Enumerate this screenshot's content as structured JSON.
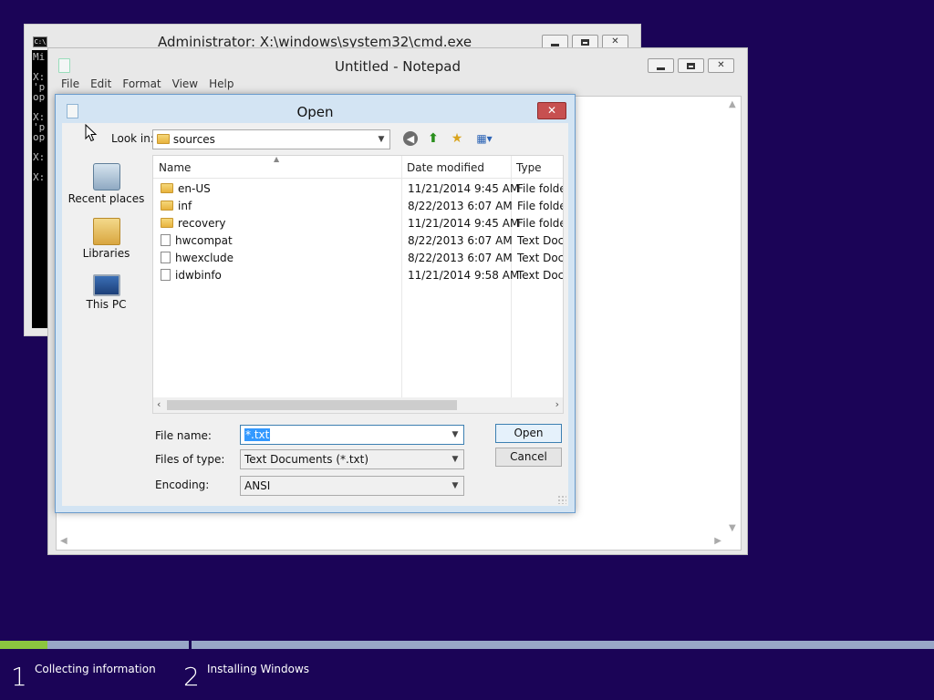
{
  "cmd": {
    "title": "Administrator: X:\\windows\\system32\\cmd.exe",
    "icon_text": "C:\\",
    "console_text": "Mi\n\nX:\n'p\nop\n\nX:\n'p\nop\n\nX:\n\nX:"
  },
  "notepad": {
    "title": "Untitled - Notepad",
    "menu": [
      "File",
      "Edit",
      "Format",
      "View",
      "Help"
    ]
  },
  "dialog": {
    "title": "Open",
    "close_glyph": "✕",
    "look_in_label": "Look in:",
    "look_in_value": "sources",
    "places": [
      {
        "label": "Recent places",
        "icon": "recent-places-icon"
      },
      {
        "label": "Libraries",
        "icon": "libraries-icon"
      },
      {
        "label": "This PC",
        "icon": "this-pc-icon"
      }
    ],
    "columns": {
      "name": "Name",
      "date": "Date modified",
      "type": "Type"
    },
    "files": [
      {
        "name": "en-US",
        "date": "11/21/2014 9:45 AM",
        "type": "File folder",
        "kind": "folder"
      },
      {
        "name": "inf",
        "date": "8/22/2013 6:07 AM",
        "type": "File folder",
        "kind": "folder"
      },
      {
        "name": "recovery",
        "date": "11/21/2014 9:45 AM",
        "type": "File folder",
        "kind": "folder"
      },
      {
        "name": "hwcompat",
        "date": "8/22/2013 6:07 AM",
        "type": "Text Docu",
        "kind": "doc"
      },
      {
        "name": "hwexclude",
        "date": "8/22/2013 6:07 AM",
        "type": "Text Docu",
        "kind": "doc"
      },
      {
        "name": "idwbinfo",
        "date": "11/21/2014 9:58 AM",
        "type": "Text Docu",
        "kind": "doc"
      }
    ],
    "file_name_label": "File name:",
    "file_name_value": "*.txt",
    "files_of_type_label": "Files of type:",
    "files_of_type_value": "Text Documents (*.txt)",
    "encoding_label": "Encoding:",
    "encoding_value": "ANSI",
    "open_label": "Open",
    "cancel_label": "Cancel"
  },
  "setup": {
    "progress": 0.25,
    "progress_color": "#8cc63f",
    "steps": [
      {
        "number": "1",
        "label": "Collecting information"
      },
      {
        "number": "2",
        "label": "Installing Windows"
      }
    ]
  },
  "colors": {
    "desktop": "#1b0457",
    "dialog_frame": "#d3e4f3",
    "close_button": "#c75050",
    "selection": "#3399ff"
  }
}
